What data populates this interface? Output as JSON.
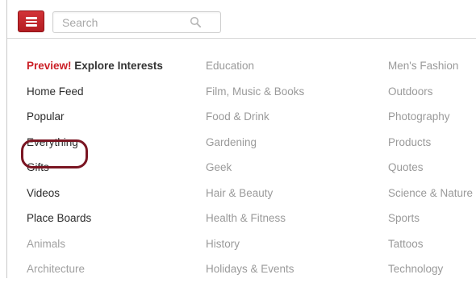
{
  "header": {
    "search_placeholder": "Search"
  },
  "menu": {
    "preview": {
      "label": "Preview!",
      "text": "Explore Interests"
    },
    "primary_items": [
      {
        "label": "Home Feed"
      },
      {
        "label": "Popular"
      },
      {
        "label": "Everything"
      },
      {
        "label": "Gifts"
      },
      {
        "label": "Videos"
      },
      {
        "label": "Place Boards"
      },
      {
        "label": "Animals"
      },
      {
        "label": "Architecture"
      }
    ],
    "category_column_2": [
      {
        "label": "Education"
      },
      {
        "label": "Film, Music & Books"
      },
      {
        "label": "Food & Drink"
      },
      {
        "label": "Gardening"
      },
      {
        "label": "Geek"
      },
      {
        "label": "Hair & Beauty"
      },
      {
        "label": "Health & Fitness"
      },
      {
        "label": "History"
      },
      {
        "label": "Holidays & Events"
      }
    ],
    "category_column_3": [
      {
        "label": "Men's Fashion"
      },
      {
        "label": "Outdoors"
      },
      {
        "label": "Photography"
      },
      {
        "label": "Products"
      },
      {
        "label": "Quotes"
      },
      {
        "label": "Science & Nature"
      },
      {
        "label": "Sports"
      },
      {
        "label": "Tattoos"
      },
      {
        "label": "Technology"
      }
    ]
  },
  "colors": {
    "accent": "#cb2027",
    "highlight_ring": "#7a1522",
    "muted_text": "#9a9a9a",
    "primary_text": "#2b2b2b"
  },
  "icons": {
    "menu": "hamburger-icon",
    "search": "search-icon"
  }
}
